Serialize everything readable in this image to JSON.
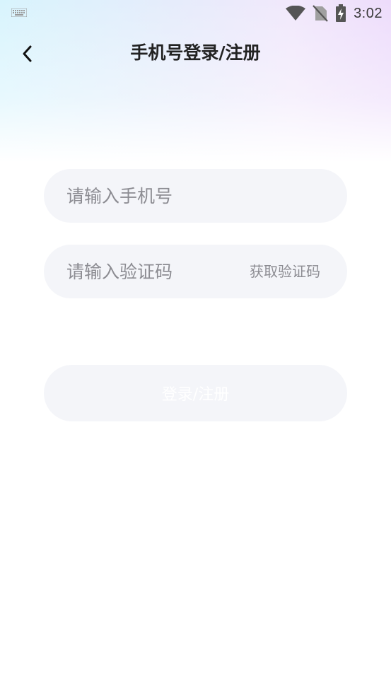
{
  "status_bar": {
    "time": "3:02",
    "icons": [
      "keyboard-icon",
      "wifi-icon",
      "no-sim-icon",
      "battery-charging-icon"
    ]
  },
  "header": {
    "title": "手机号登录/注册",
    "back_icon": "chevron-left-icon"
  },
  "form": {
    "phone_placeholder": "请输入手机号",
    "phone_value": "",
    "code_placeholder": "请输入验证码",
    "code_value": "",
    "get_code_label": "获取验证码",
    "submit_label": "登录/注册"
  },
  "colors": {
    "field_bg": "#f4f5f9",
    "placeholder": "#8c8c92",
    "title": "#222222",
    "gradient_left": "#d8f4fd",
    "gradient_right": "#eddcfb"
  }
}
